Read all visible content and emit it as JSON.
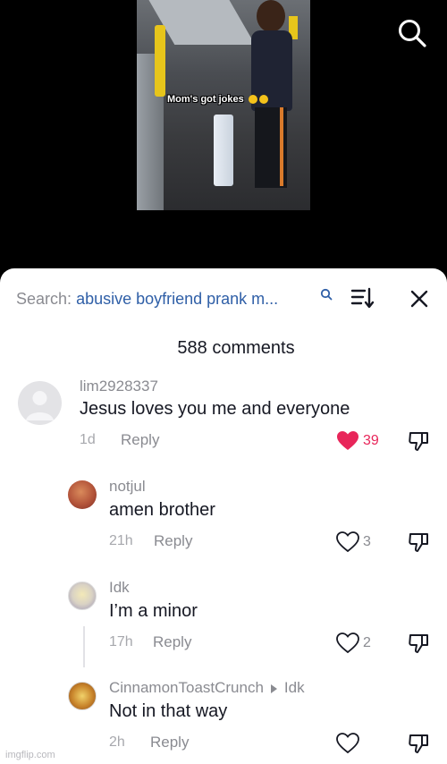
{
  "video": {
    "caption": "Mom's got jokes"
  },
  "icons": {
    "top_search": "search-icon",
    "sort": "sort-icon",
    "close": "close-icon",
    "like": "heart-icon",
    "dislike": "thumbs-down-icon"
  },
  "sheet": {
    "search_prefix": "Search:",
    "search_query": "abusive boyfriend prank m...",
    "comment_count": "588 comments"
  },
  "comments": [
    {
      "user": "lim2928337",
      "text": "Jesus loves you me and everyone",
      "time": "1d",
      "reply": "Reply",
      "likes": "39",
      "liked": true
    },
    {
      "user": "notjul",
      "text": "amen brother",
      "time": "21h",
      "reply": "Reply",
      "likes": "3",
      "liked": false
    },
    {
      "user": "Idk",
      "text": "I’m a minor",
      "time": "17h",
      "reply": "Reply",
      "likes": "2",
      "liked": false
    },
    {
      "user": "CinnamonToastCrunch",
      "reply_to": "Idk",
      "text": "Not in that way",
      "time": "2h",
      "reply": "Reply",
      "likes": "",
      "liked": false
    }
  ],
  "colors": {
    "accent_like": "#e8265a",
    "link_blue": "#2f5fa7",
    "muted_gray": "#8a8b91"
  },
  "watermark": "imgflip.com"
}
